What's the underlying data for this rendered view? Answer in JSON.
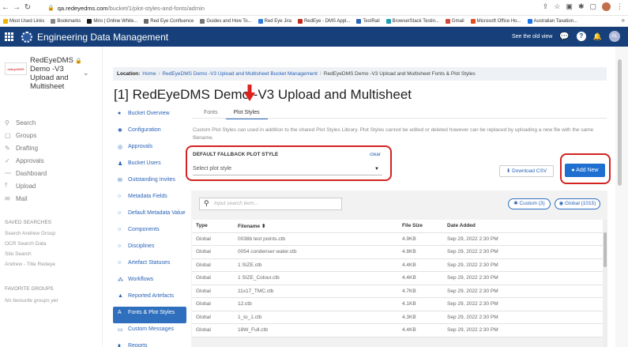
{
  "browser": {
    "url_host": "qa.redeyedms.com",
    "url_path": "/bucket/1/plot-styles-and-fonts/admin",
    "bookmarks": [
      "Most Used Links",
      "Bookmarks",
      "Miro | Online White...",
      "Red Eye Confluence",
      "Guides and How To...",
      "Red Eye Jira",
      "RedEye - DMS Appl...",
      "TestRail",
      "BrowserStack Testin...",
      "Gmail",
      "Microsoft Office Ho...",
      "Australian Taxation..."
    ],
    "bookmarks_more": "»"
  },
  "header": {
    "app_title": "Engineering Data Management",
    "see_old_view": "See the old view",
    "help_label": "?",
    "avatar_initials": "AL"
  },
  "sidebar": {
    "brand": "redeyeDMS",
    "bucket_name": "RedEyeDMS Demo -V3 Upload and Multisheet",
    "nav": [
      {
        "icon": "search-icon",
        "glyph": "⚲",
        "label": "Search"
      },
      {
        "icon": "groups-icon",
        "glyph": "▢",
        "label": "Groups"
      },
      {
        "icon": "drafting-icon",
        "glyph": "✎",
        "label": "Drafting"
      },
      {
        "icon": "approvals-icon",
        "glyph": "✓",
        "label": "Approvals"
      },
      {
        "icon": "dashboard-icon",
        "glyph": "〰",
        "label": "Dashboard"
      },
      {
        "icon": "upload-icon",
        "glyph": "⤒",
        "label": "Upload"
      },
      {
        "icon": "mail-icon",
        "glyph": "✉",
        "label": "Mail"
      }
    ],
    "saved_searches_heading": "SAVED SEARCHES",
    "saved_searches": [
      "Search Andrew Group",
      "OCR Search Data",
      "Site Search",
      "Andrew - Title Redeye"
    ],
    "favorite_groups_heading": "FAVORITE GROUPS",
    "no_favorite_groups": "No favourite groups yet"
  },
  "subnav": [
    {
      "icon": "bucket-overview-icon",
      "glyph": "●",
      "label": "Bucket Overview"
    },
    {
      "icon": "configuration-icon",
      "glyph": "✱",
      "label": "Configuration"
    },
    {
      "icon": "approvals-icon",
      "glyph": "◎",
      "label": "Approvals"
    },
    {
      "icon": "bucket-users-icon",
      "glyph": "♟",
      "label": "Bucket Users"
    },
    {
      "icon": "outstanding-invites-icon",
      "glyph": "✉",
      "label": "Outstanding Invites"
    },
    {
      "icon": "metadata-fields-icon",
      "glyph": "○",
      "label": "Metadata Fields"
    },
    {
      "icon": "default-metadata-icon",
      "glyph": "○",
      "label": "Default Metadata Value"
    },
    {
      "icon": "components-icon",
      "glyph": "○",
      "label": "Components"
    },
    {
      "icon": "disciplines-icon",
      "glyph": "○",
      "label": "Disciplines"
    },
    {
      "icon": "artefact-statuses-icon",
      "glyph": "○",
      "label": "Artefact Statuses"
    },
    {
      "icon": "workflows-icon",
      "glyph": "⁂",
      "label": "Workflows"
    },
    {
      "icon": "reported-artefacts-icon",
      "glyph": "▲",
      "label": "Reported Artefacts"
    },
    {
      "icon": "fonts-plot-styles-icon",
      "glyph": "A",
      "label": "Fonts & Plot Styles",
      "active": true
    },
    {
      "icon": "custom-messages-icon",
      "glyph": "▭",
      "label": "Custom Messages"
    },
    {
      "icon": "reports-icon",
      "glyph": "▮",
      "label": "Reports"
    }
  ],
  "breadcrumb": {
    "label": "Location:",
    "items": [
      "Home",
      "RedEyeDMS Demo -V3 Upload and Multisheet Bucket Management"
    ],
    "current": "RedEyeDMS Demo -V3 Upload and Multisheet Fonts & Plot Styles"
  },
  "page": {
    "title": "[1] RedEyeDMS Demo -V3 Upload and Multisheet",
    "tabs": [
      "Fonts",
      "Plot Styles"
    ],
    "active_tab": "Plot Styles",
    "description": "Custom Plot Styles can used in addition to the shared Plot Styles Library. Plot Styles cannot be edited or deleted however can be replaced by uploading a new file with the same filename."
  },
  "fallback": {
    "label": "DEFAULT FALLBACK PLOT STYLE",
    "clear": "clear",
    "select_placeholder": "Select plot style"
  },
  "actions": {
    "download_csv": "⬇ Download CSV",
    "add_new": "● Add New"
  },
  "search": {
    "placeholder": "Input search term..."
  },
  "filters": {
    "custom": "✱ Custom (3)",
    "global": "◉ Global (1015)"
  },
  "table": {
    "columns": [
      "Type",
      "Filename ⬍",
      "File Size",
      "Date Added"
    ],
    "rows": [
      [
        "Global",
        "0038b test points.ctb",
        "4.9KB",
        "Sep 29, 2022 2:30 PM"
      ],
      [
        "Global",
        "0054 condenser water.ctb",
        "4.8KB",
        "Sep 29, 2022 2:30 PM"
      ],
      [
        "Global",
        "1 SIZE.ctb",
        "4.4KB",
        "Sep 29, 2022 2:30 PM"
      ],
      [
        "Global",
        "1 SIZE_Colour.ctb",
        "4.4KB",
        "Sep 29, 2022 2:30 PM"
      ],
      [
        "Global",
        "11x17_TMC.ctb",
        "4.7KB",
        "Sep 29, 2022 2:30 PM"
      ],
      [
        "Global",
        "12.ctb",
        "4.1KB",
        "Sep 29, 2022 2:30 PM"
      ],
      [
        "Global",
        "1_to_1.ctb",
        "4.3KB",
        "Sep 29, 2022 2:30 PM"
      ],
      [
        "Global",
        "18W_Full.ctb",
        "4.4KB",
        "Sep 29, 2022 2:30 PM"
      ]
    ]
  }
}
